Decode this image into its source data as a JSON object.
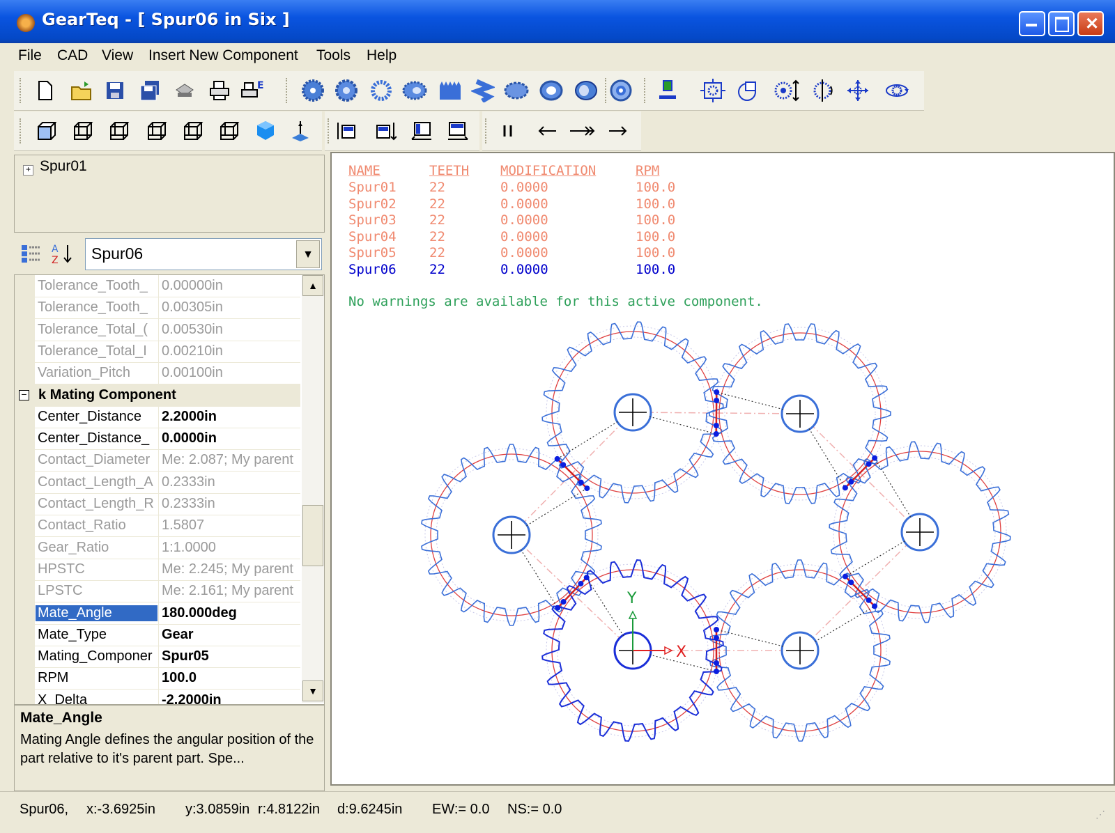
{
  "window": {
    "title": "GearTeq - [ Spur06 in  Six ]"
  },
  "menu": [
    "File",
    "CAD",
    "View",
    "Insert New Component",
    "Tools",
    "Help"
  ],
  "tree": {
    "root": "Spur01"
  },
  "property_panel": {
    "selected_component": "Spur06",
    "rows": [
      {
        "name": "Tolerance_Tooth_",
        "value": "0.00000in",
        "style": "dim"
      },
      {
        "name": "Tolerance_Tooth_",
        "value": "0.00305in",
        "style": "dim"
      },
      {
        "name": "Tolerance_Total_(",
        "value": "0.00530in",
        "style": "dim"
      },
      {
        "name": "Tolerance_Total_I",
        "value": "0.00210in",
        "style": "dim"
      },
      {
        "name": "Variation_Pitch",
        "value": "0.00100in",
        "style": "dim"
      },
      {
        "name": "k Mating Component",
        "value": "",
        "style": "cat"
      },
      {
        "name": "Center_Distance",
        "value": "2.2000in",
        "style": "bold"
      },
      {
        "name": "Center_Distance_",
        "value": "0.0000in",
        "style": "bold"
      },
      {
        "name": "Contact_Diameter",
        "value": "Me: 2.087; My parent",
        "style": "dim"
      },
      {
        "name": "Contact_Length_A",
        "value": "0.2333in",
        "style": "dim"
      },
      {
        "name": "Contact_Length_R",
        "value": "0.2333in",
        "style": "dim"
      },
      {
        "name": "Contact_Ratio",
        "value": "1.5807",
        "style": "dim"
      },
      {
        "name": "Gear_Ratio",
        "value": "1:1.0000",
        "style": "dim"
      },
      {
        "name": "HPSTC",
        "value": "Me: 2.245; My parent",
        "style": "dim"
      },
      {
        "name": "LPSTC",
        "value": "Me: 2.161; My parent",
        "style": "dim"
      },
      {
        "name": "Mate_Angle",
        "value": "180.000deg",
        "style": "sel"
      },
      {
        "name": "Mate_Type",
        "value": "Gear",
        "style": "bold"
      },
      {
        "name": "Mating_Componer",
        "value": "Spur05",
        "style": "bold"
      },
      {
        "name": "RPM",
        "value": "100.0",
        "style": "bold"
      },
      {
        "name": "X_Delta",
        "value": "-2.2000in",
        "style": "bold"
      }
    ]
  },
  "description": {
    "title": "Mate_Angle",
    "body": "Mating Angle defines the angular position of the part relative to it's parent part. Spe..."
  },
  "gear_table": {
    "headers": [
      "NAME",
      "TEETH",
      "MODIFICATION",
      "RPM"
    ],
    "rows": [
      [
        "Spur01",
        "22",
        "0.0000",
        "100.0"
      ],
      [
        "Spur02",
        "22",
        "0.0000",
        "100.0"
      ],
      [
        "Spur03",
        "22",
        "0.0000",
        "100.0"
      ],
      [
        "Spur04",
        "22",
        "0.0000",
        "100.0"
      ],
      [
        "Spur05",
        "22",
        "0.0000",
        "100.0"
      ],
      [
        "Spur06",
        "22",
        "0.0000",
        "100.0"
      ]
    ],
    "active_row": 5,
    "message": "No warnings are available for this active component."
  },
  "axes": {
    "x": "X",
    "y": "Y"
  },
  "status": {
    "component": "Spur06,",
    "x": "x:-3.6925in",
    "y": "y:3.0859in",
    "r": "r:4.8122in",
    "d": "d:9.6245in",
    "ew": "EW:= 0.0",
    "ns": "NS:= 0.0"
  },
  "colors": {
    "table_text": "#f08a70",
    "active_text": "#0000cc",
    "message": "#2ea05a",
    "gear_blue": "#3a6fd8",
    "pitch_red": "#e04040",
    "selection": "#316ac5"
  }
}
